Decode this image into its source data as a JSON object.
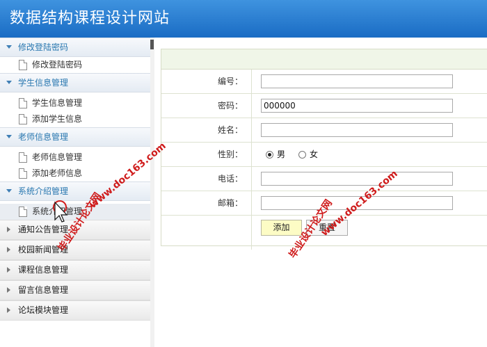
{
  "header": {
    "title": "数据结构课程设计网站"
  },
  "sidebar": {
    "groups": [
      {
        "title": "修改登陆密码",
        "items": [
          "修改登陆密码"
        ]
      },
      {
        "title": "学生信息管理",
        "items": [
          "学生信息管理",
          "添加学生信息"
        ]
      },
      {
        "title": "老师信息管理",
        "items": [
          "老师信息管理",
          "添加老师信息"
        ]
      },
      {
        "title": "系统介绍管理",
        "items": [
          "系统介绍管理"
        ]
      }
    ],
    "collapsed": [
      "通知公告管理",
      "校园新闻管理",
      "课程信息管理",
      "留言信息管理",
      "论坛模块管理"
    ]
  },
  "form": {
    "number_label": "编号：",
    "number_value": "",
    "password_label": "密码：",
    "password_value": "000000",
    "name_label": "姓名：",
    "name_value": "",
    "gender_label": "性别：",
    "gender_options": [
      "男",
      "女"
    ],
    "gender_selected": "男",
    "phone_label": "电话：",
    "phone_value": "",
    "email_label": "邮箱：",
    "email_value": "",
    "add_label": "添加",
    "reset_label": "重置"
  },
  "watermark": {
    "line1": "毕业设计论文网",
    "line2": "www.doc163.com"
  },
  "colors": {
    "header": "#2a7fd4",
    "accent": "#2a78b0",
    "add_button": "#fdfcc5",
    "watermark": "#cf1b1b"
  }
}
